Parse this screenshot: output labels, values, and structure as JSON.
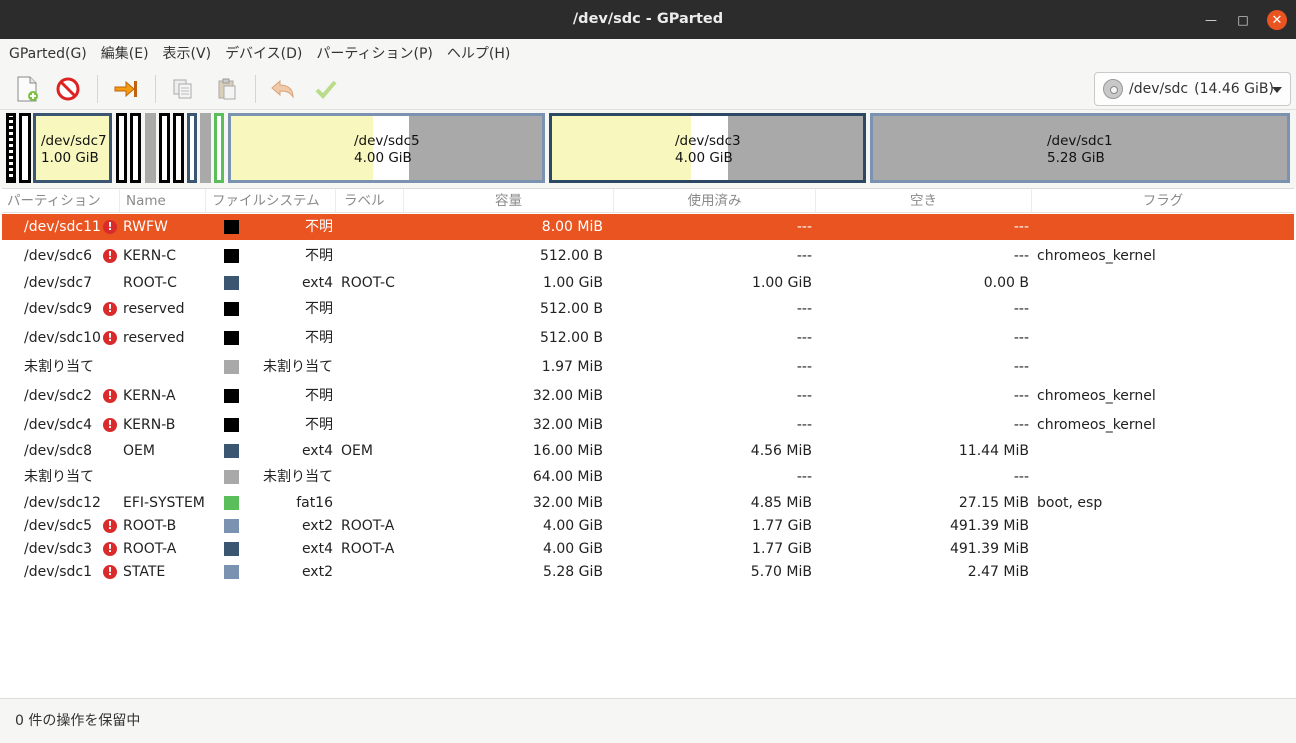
{
  "window": {
    "title": "/dev/sdc - GParted",
    "minimize_icon": "minimize-icon",
    "maximize_icon": "maximize-icon",
    "close_icon": "close-icon"
  },
  "menu": [
    "GParted(G)",
    "編集(E)",
    "表示(V)",
    "デバイス(D)",
    "パーティション(P)",
    "ヘルプ(H)"
  ],
  "toolbar": {
    "icons": [
      "new-partition-icon",
      "delete-icon",
      "resize-move-icon",
      "copy-icon",
      "paste-icon",
      "undo-icon",
      "apply-icon"
    ],
    "device_selector": {
      "icon": "harddisk-icon",
      "device": "/dev/sdc",
      "size": "(14.46 GiB)"
    }
  },
  "partition_map": [
    {
      "name": "/dev/sdc7",
      "size": "1.00 GiB"
    },
    {
      "name": "/dev/sdc5",
      "size": "4.00 GiB"
    },
    {
      "name": "/dev/sdc3",
      "size": "4.00 GiB"
    },
    {
      "name": "/dev/sdc1",
      "size": "5.28 GiB"
    }
  ],
  "columns": [
    "パーティション",
    "Name",
    "ファイルシステム",
    "ラベル",
    "容量",
    "使用済み",
    "空き",
    "フラグ"
  ],
  "rows": [
    {
      "partition": "/dev/sdc11",
      "warn": true,
      "name": "RWFW",
      "color": "#000000",
      "fs": "不明",
      "label": "",
      "size": "8.00 MiB",
      "used": "---",
      "free": "---",
      "flags": ""
    },
    {
      "partition": "/dev/sdc6",
      "warn": true,
      "name": "KERN-C",
      "color": "#000000",
      "fs": "不明",
      "label": "",
      "size": "512.00 B",
      "used": "---",
      "free": "---",
      "flags": "chromeos_kernel"
    },
    {
      "partition": "/dev/sdc7",
      "warn": false,
      "name": "ROOT-C",
      "color": "#3b5670",
      "fs": "ext4",
      "label": "ROOT-C",
      "size": "1.00 GiB",
      "used": "1.00 GiB",
      "free": "0.00 B",
      "flags": ""
    },
    {
      "partition": "/dev/sdc9",
      "warn": true,
      "name": "reserved",
      "color": "#000000",
      "fs": "不明",
      "label": "",
      "size": "512.00 B",
      "used": "---",
      "free": "---",
      "flags": ""
    },
    {
      "partition": "/dev/sdc10",
      "warn": true,
      "name": "reserved",
      "color": "#000000",
      "fs": "不明",
      "label": "",
      "size": "512.00 B",
      "used": "---",
      "free": "---",
      "flags": ""
    },
    {
      "partition": "未割り当て",
      "warn": false,
      "name": "",
      "color": "#a9a9a9",
      "fs": "未割り当て",
      "label": "",
      "size": "1.97 MiB",
      "used": "---",
      "free": "---",
      "flags": ""
    },
    {
      "partition": "/dev/sdc2",
      "warn": true,
      "name": "KERN-A",
      "color": "#000000",
      "fs": "不明",
      "label": "",
      "size": "32.00 MiB",
      "used": "---",
      "free": "---",
      "flags": "chromeos_kernel"
    },
    {
      "partition": "/dev/sdc4",
      "warn": true,
      "name": "KERN-B",
      "color": "#000000",
      "fs": "不明",
      "label": "",
      "size": "32.00 MiB",
      "used": "---",
      "free": "---",
      "flags": "chromeos_kernel"
    },
    {
      "partition": "/dev/sdc8",
      "warn": false,
      "name": "OEM",
      "color": "#3b5670",
      "fs": "ext4",
      "label": "OEM",
      "size": "16.00 MiB",
      "used": "4.56 MiB",
      "free": "11.44 MiB",
      "flags": ""
    },
    {
      "partition": "未割り当て",
      "warn": false,
      "name": "",
      "color": "#a9a9a9",
      "fs": "未割り当て",
      "label": "",
      "size": "64.00 MiB",
      "used": "---",
      "free": "---",
      "flags": ""
    },
    {
      "partition": "/dev/sdc12",
      "warn": false,
      "name": "EFI-SYSTEM",
      "color": "#5abf5a",
      "fs": "fat16",
      "label": "",
      "size": "32.00 MiB",
      "used": "4.85 MiB",
      "free": "27.15 MiB",
      "flags": "boot, esp"
    },
    {
      "partition": "/dev/sdc5",
      "warn": true,
      "name": "ROOT-B",
      "color": "#7b93b0",
      "fs": "ext2",
      "label": "ROOT-A",
      "size": "4.00 GiB",
      "used": "1.77 GiB",
      "free": "491.39 MiB",
      "flags": ""
    },
    {
      "partition": "/dev/sdc3",
      "warn": true,
      "name": "ROOT-A",
      "color": "#3b5670",
      "fs": "ext4",
      "label": "ROOT-A",
      "size": "4.00 GiB",
      "used": "1.77 GiB",
      "free": "491.39 MiB",
      "flags": ""
    },
    {
      "partition": "/dev/sdc1",
      "warn": true,
      "name": "STATE",
      "color": "#7b93b0",
      "fs": "ext2",
      "label": "",
      "size": "5.28 GiB",
      "used": "5.70 MiB",
      "free": "2.47 MiB",
      "flags": ""
    }
  ],
  "selected_row": 0,
  "status": "0 件の操作を保留中",
  "colors": {
    "accent": "#e95420",
    "titlebar": "#2c2c2c",
    "used": "#f8f8be",
    "unallocated": "#a9a9a9"
  }
}
